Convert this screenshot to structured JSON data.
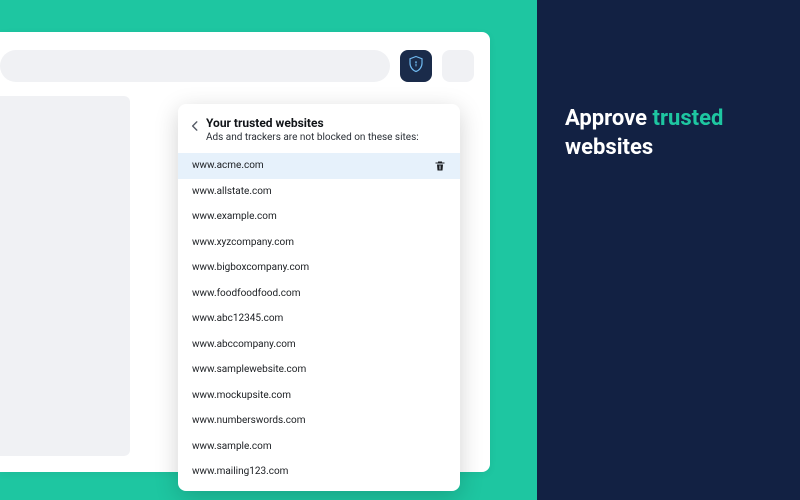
{
  "colors": {
    "teal": "#1ec6a1",
    "navy": "#122143",
    "shieldNavy": "#1a2b4a"
  },
  "popup": {
    "title": "Your trusted websites",
    "subtitle": "Ads and trackers are not blocked on these sites:",
    "sites": [
      "www.acme.com",
      "www.allstate.com",
      "www.example.com",
      "www.xyzcompany.com",
      "www.bigboxcompany.com",
      "www.foodfoodfood.com",
      "www.abc12345.com",
      "www.abccompany.com",
      "www.samplewebsite.com",
      "www.mockupsite.com",
      "www.numberswords.com",
      "www.sample.com",
      "www.mailing123.com"
    ]
  },
  "marketing": {
    "line1_prefix": "Approve ",
    "line1_accent": "trusted",
    "line2": "websites"
  }
}
